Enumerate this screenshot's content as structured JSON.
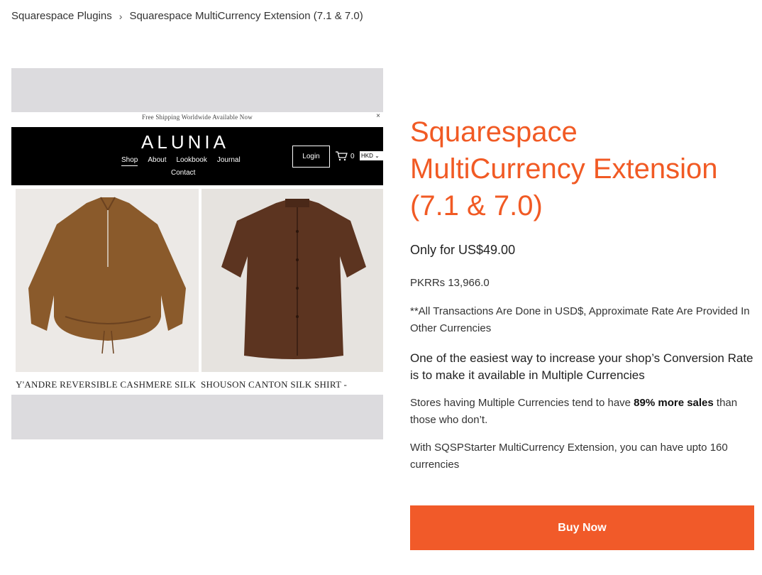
{
  "breadcrumb": {
    "parent": "Squarespace Plugins",
    "separator": "›",
    "current": "Squarespace MultiCurrency Extension (7.1 & 7.0)"
  },
  "gallery": {
    "screenshot": {
      "announcement": "Free Shipping Worldwide Available Now",
      "close_glyph": "×",
      "brand": "ALUNIA",
      "menu": [
        "Shop",
        "About",
        "Lookbook",
        "Journal"
      ],
      "menu_second_row": "Contact",
      "login_label": "Login",
      "cart_count": "0",
      "currency": "HKD",
      "products": [
        {
          "caption": "Y'ANDRE REVERSIBLE CASHMERE SILK",
          "color": "#8a5a2b"
        },
        {
          "caption": "SHOUSON CANTON SILK SHIRT -",
          "color": "#5c3420"
        }
      ]
    }
  },
  "product": {
    "title": "Squarespace MultiCurrency Extension (7.1 & 7.0)",
    "price": "Only for US$49.00",
    "local_price": "PKRRs 13,966.0",
    "note": "**All Transactions Are Done in USD$, Approximate Rate Are Provided In Other Currencies",
    "lead": "One of the easiest way to increase your shop’s Conversion Rate is to make it available in Multiple Currencies",
    "stat_prefix": "Stores having Multiple Currencies tend to have ",
    "stat_bold": "89% more sales",
    "stat_suffix": " than those who don’t.",
    "feature": "With SQSPStarter MultiCurrency Extension, you can have upto 160 currencies",
    "buy_label": "Buy Now"
  },
  "colors": {
    "accent": "#f15a24",
    "button": "#f15a29"
  }
}
